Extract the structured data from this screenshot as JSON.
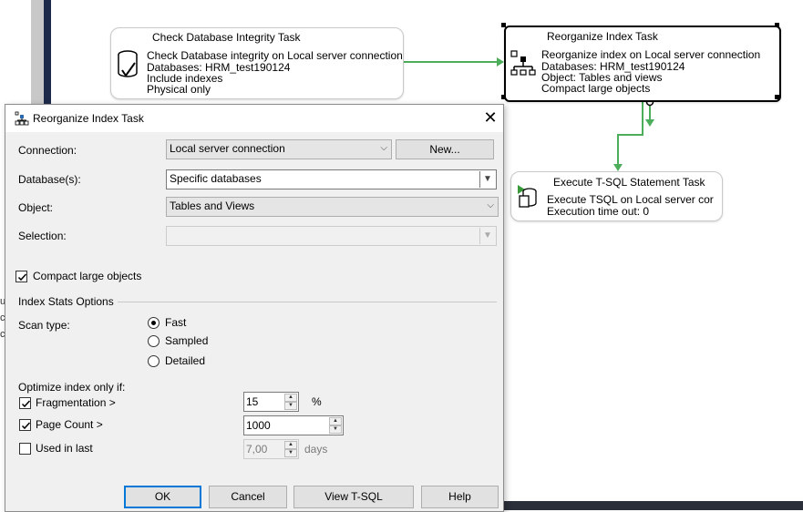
{
  "designer": {
    "side_letters": [
      "u",
      "c",
      "c"
    ],
    "tasks": {
      "check": {
        "title": "Check Database Integrity Task",
        "lines": [
          "Check Database integrity on Local server connection",
          "Databases: HRM_test190124",
          "Include indexes",
          "Physical only"
        ],
        "icon": "database-check-icon"
      },
      "reorg": {
        "title": "Reorganize Index Task",
        "lines": [
          "Reorganize index on Local server connection",
          "Databases: HRM_test190124",
          "Object: Tables and views",
          "Compact large objects"
        ],
        "icon": "index-tree-icon"
      },
      "exec": {
        "title": "Execute T-SQL Statement Task",
        "lines": [
          "Execute TSQL on Local server cor",
          "Execution time out: 0"
        ],
        "icon": "tsql-task-icon"
      }
    },
    "connector_color": "#4cae5b"
  },
  "dialog": {
    "title": "Reorganize Index Task",
    "close_label": "✕",
    "connection": {
      "label": "Connection:",
      "value": "Local server connection",
      "new_button": "New..."
    },
    "databases": {
      "label": "Database(s):",
      "value": "Specific databases"
    },
    "object": {
      "label": "Object:",
      "value": "Tables and Views"
    },
    "selection": {
      "label": "Selection:",
      "value": ""
    },
    "compact": {
      "label": "Compact large objects",
      "checked": true
    },
    "index_stats": {
      "section_label": "Index Stats Options",
      "scan_type_label": "Scan type:",
      "options": [
        {
          "label": "Fast",
          "selected": true
        },
        {
          "label": "Sampled",
          "selected": false
        },
        {
          "label": "Detailed",
          "selected": false
        }
      ]
    },
    "optimize": {
      "header": "Optimize index only if:",
      "fragmentation": {
        "label": "Fragmentation >",
        "value": "15",
        "unit": "%",
        "checked": true
      },
      "page_count": {
        "label": "Page Count >",
        "value": "1000",
        "checked": true
      },
      "used_in_last": {
        "label": "Used  in last",
        "value": "7,00",
        "unit": "days",
        "checked": false
      }
    },
    "buttons": {
      "ok": "OK",
      "cancel": "Cancel",
      "view_tsql": "View T-SQL",
      "help": "Help"
    }
  }
}
